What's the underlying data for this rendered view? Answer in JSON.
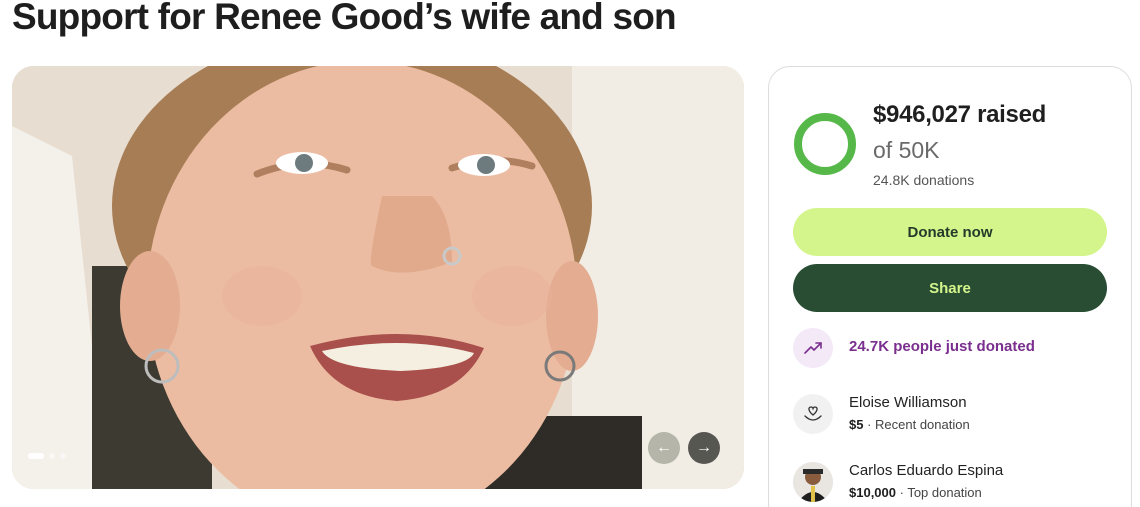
{
  "page": {
    "title": "Support for Renee Good’s wife and son"
  },
  "gallery": {
    "photo": "smiling-person-photo",
    "slide_index": 1,
    "slide_count": 3,
    "prev_icon": "arrow-left-icon",
    "next_icon": "arrow-right-icon"
  },
  "donation_card": {
    "raised": "$946,027 raised",
    "goal": "of 50K",
    "donations": "24.8K donations",
    "progress_fraction": 1.0,
    "donate_label": "Donate now",
    "share_label": "Share",
    "trend_text": "24.7K people just donated",
    "recent": [
      {
        "name": "Eloise Williamson",
        "amount": "$5",
        "label": " · Recent donation"
      },
      {
        "name": "Carlos Eduardo Espina",
        "amount": "$10,000",
        "label": " · Top donation"
      }
    ]
  },
  "colors": {
    "progress": "#57b84a",
    "donate_bg": "#d4f48c",
    "share_bg": "#284d33",
    "trend_text": "#7a2e8e"
  }
}
